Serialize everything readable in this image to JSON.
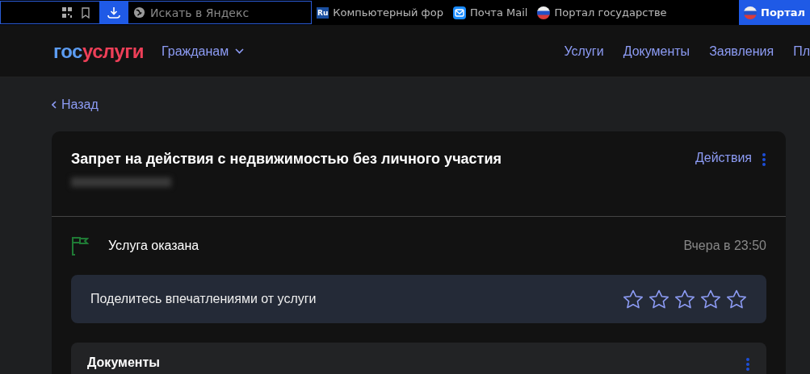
{
  "browser_bar": {
    "search": {
      "placeholder": "Искать в Яндекс"
    },
    "bookmarks": [
      {
        "kind": "ru",
        "badge": "Ru",
        "label": "Компьютерный фор",
        "selected": false
      },
      {
        "kind": "mail",
        "label": "Почта Mail",
        "selected": false
      },
      {
        "kind": "flag",
        "label": "Портал государстве",
        "selected": false
      },
      {
        "kind": "flag",
        "label": "Портал",
        "selected": true
      }
    ]
  },
  "header": {
    "logo": {
      "first": "гос",
      "second": "услуги"
    },
    "audience": "Гражданам",
    "nav": [
      "Услуги",
      "Документы",
      "Заявления",
      "Пл"
    ]
  },
  "back": "Назад",
  "card": {
    "title": "Запрет на действия с недвижимостью без личного участия",
    "actions": "Действия",
    "status": {
      "label": "Услуга оказана",
      "time": "Вчера в 23:50"
    },
    "rating": {
      "prompt": "Поделитесь впечатлениями от услуги",
      "stars": 0
    },
    "documents": {
      "title": "Документы"
    }
  }
}
